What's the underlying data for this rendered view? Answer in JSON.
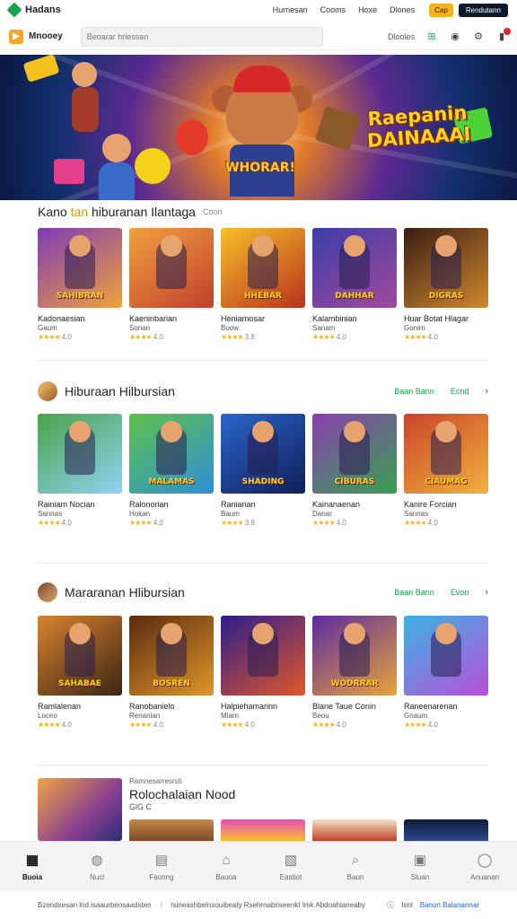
{
  "topbar": {
    "logo": "Hadans",
    "nav": [
      "Hurnesan",
      "Cooms",
      "Hoxe",
      "Dlones"
    ],
    "button_yellow": "Cap",
    "button_dark": "Rendutann"
  },
  "header": {
    "brand": "Mnooey",
    "search_placeholder": "Beoarar hrlessan",
    "right_label": "Dlooles"
  },
  "hero": {
    "title_line1": "Raepanin",
    "title_line2": "DAINAAAI",
    "badge": "WHORAR!"
  },
  "section1": {
    "title_a": "Kano",
    "title_b": "tan",
    "title_c": "hiburanan Ilantaga",
    "sub": "Coon",
    "cards": [
      {
        "label": "SAHIBRAN",
        "name": "Kadonaesian",
        "sub": "Gaum",
        "rating": "4.0",
        "c1": "#7d3bb5",
        "c2": "#f1a23b"
      },
      {
        "label": "",
        "name": "Kaeninbarian",
        "sub": "Sonan",
        "rating": "4.0",
        "c1": "#f0a040",
        "c2": "#c0412b"
      },
      {
        "label": "HHEBAR",
        "name": "Heniarnosar",
        "sub": "Buow",
        "rating": "3.8",
        "c1": "#f5c02a",
        "c2": "#b8331d"
      },
      {
        "label": "DAHHAR",
        "name": "Kalambinian",
        "sub": "Sanam",
        "rating": "4.0",
        "c1": "#3b3ea8",
        "c2": "#a14a9a"
      },
      {
        "label": "DIGRAS",
        "name": "Huar Botat Hlagar",
        "sub": "Gonim",
        "rating": "4.0",
        "c1": "#3a1d12",
        "c2": "#d0892f"
      }
    ]
  },
  "section2": {
    "title": "Hiburaan Hilbursian",
    "link1": "Baan Bann",
    "link2": "Ecnd",
    "cards": [
      {
        "label": "",
        "name": "Rainiam Nocian",
        "sub": "Sannas",
        "rating": "4.0",
        "c1": "#4aa34a",
        "c2": "#8fd3f4"
      },
      {
        "label": "MALAMAS",
        "name": "Ralonorian",
        "sub": "Hokan",
        "rating": "4.0",
        "c1": "#5fc14a",
        "c2": "#2e8fd6"
      },
      {
        "label": "SHADING",
        "name": "Raniarian",
        "sub": "Baum",
        "rating": "3.8",
        "c1": "#2b65c9",
        "c2": "#0f1f5a"
      },
      {
        "label": "CIBURAS",
        "name": "Kainanaenan",
        "sub": "Danar",
        "rating": "4.0",
        "c1": "#8a3fb0",
        "c2": "#38a24f"
      },
      {
        "label": "CIAUMAG",
        "name": "Kanire Forcian",
        "sub": "Sannas",
        "rating": "4.0",
        "c1": "#c9442a",
        "c2": "#f0b23b"
      }
    ]
  },
  "section3": {
    "title": "Mararanan Hlibursian",
    "link1": "Baan Bann",
    "link2": "Evon",
    "cards": [
      {
        "label": "SAHABAE",
        "name": "Ramlalenan",
        "sub": "Loceo",
        "rating": "4.0",
        "c1": "#d8832f",
        "c2": "#3a2514"
      },
      {
        "label": "BOSREN",
        "name": "Ranobanielo",
        "sub": "Renanian",
        "rating": "4.0",
        "c1": "#5a2a0f",
        "c2": "#e0962b"
      },
      {
        "label": "",
        "name": "Halpiehamarinn",
        "sub": "Mlarn",
        "rating": "4.0",
        "c1": "#2a1d8a",
        "c2": "#e2572c"
      },
      {
        "label": "WODRRAR",
        "name": "Blane Taue Conin",
        "sub": "Beou",
        "rating": "4.0",
        "c1": "#5b2aa0",
        "c2": "#e8a43a"
      },
      {
        "label": "",
        "name": "Raneenarenan",
        "sub": "Gnaum",
        "rating": "4.0",
        "c1": "#3db2e4",
        "c2": "#b84fd8"
      }
    ]
  },
  "promo": {
    "tag": "Ramnesarresrsti",
    "title": "Rolochalaian Nood",
    "sub": "GlG C"
  },
  "bottom_nav": [
    {
      "label": "Buoia",
      "icon": "grid-icon",
      "glyph": "▦"
    },
    {
      "label": "Nucl",
      "icon": "ball-icon",
      "glyph": "◍"
    },
    {
      "label": "Faonng",
      "icon": "chart-icon",
      "glyph": "▤"
    },
    {
      "label": "Bauoa",
      "icon": "basket-icon",
      "glyph": "⌂"
    },
    {
      "label": "Eastiot",
      "icon": "map-icon",
      "glyph": "▧"
    },
    {
      "label": "Baun",
      "icon": "search-icon",
      "glyph": "⌕"
    },
    {
      "label": "Sluan",
      "icon": "card-icon",
      "glyph": "▣"
    },
    {
      "label": "Anuanan",
      "icon": "user-icon",
      "glyph": "◯"
    }
  ],
  "footer": {
    "left": "Bzendxesan lnd isaaurbeosaadsten",
    "middle": "lsineashbelnsouibeaty Rsehrnabriseenkt Imk Abdoahlaneaby",
    "right_small": "Isnl",
    "right_link": "Banon Balanannar"
  }
}
